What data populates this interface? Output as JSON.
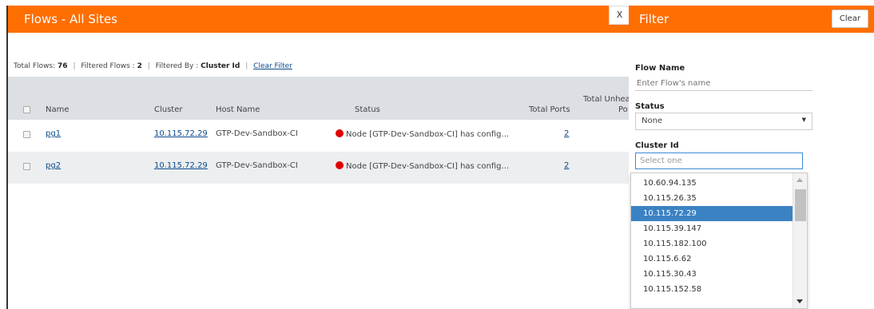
{
  "main": {
    "title": "Flows - All Sites",
    "close_label": "X",
    "summary": {
      "total_flows_label": "Total Flows:",
      "total_flows_value": "76",
      "filtered_flows_label": "Filtered Flows :",
      "filtered_flows_value": "2",
      "filtered_by_label": "Filtered By :",
      "filtered_by_value": "Cluster Id",
      "clear_filter_label": "Clear Filter"
    },
    "columns": {
      "name": "Name",
      "cluster": "Cluster",
      "host_name": "Host Name",
      "status": "Status",
      "total_ports": "Total Ports",
      "total_unhealthy_1": "Total Unhealt",
      "total_unhealthy_2": "Po"
    },
    "rows": [
      {
        "name": "pg1",
        "cluster": "10.115.72.29",
        "host": "GTP-Dev-Sandbox-CI",
        "status": "Node [GTP-Dev-Sandbox-CI] has config...",
        "ports": "2"
      },
      {
        "name": "pg2",
        "cluster": "10.115.72.29",
        "host": "GTP-Dev-Sandbox-CI",
        "status": "Node [GTP-Dev-Sandbox-CI] has config...",
        "ports": "2"
      }
    ]
  },
  "filter": {
    "title": "Filter",
    "clear_label": "Clear",
    "flow_name_label": "Flow Name",
    "flow_name_placeholder": "Enter Flow's name",
    "status_label": "Status",
    "status_value": "None",
    "cluster_label": "Cluster Id",
    "cluster_placeholder": "Select one",
    "cluster_options": [
      "10.60.94.135",
      "10.115.26.35",
      "10.115.72.29",
      "10.115.39.147",
      "10.115.182.100",
      "10.115.6.62",
      "10.115.30.43",
      "10.115.152.58"
    ],
    "cluster_selected": "10.115.72.29"
  },
  "colors": {
    "header": "#ff6e00",
    "selected": "#3b82c4",
    "status_error": "#e00000",
    "link": "#0a4a8a"
  }
}
